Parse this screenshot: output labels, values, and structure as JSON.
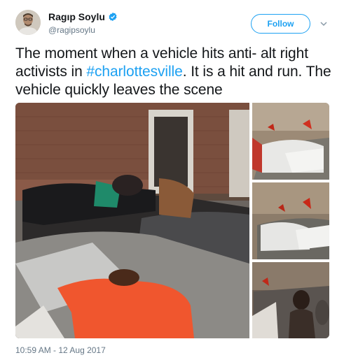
{
  "author": {
    "name": "Ragıp Soylu",
    "handle": "@ragipsoylu",
    "verified": true
  },
  "follow_button": {
    "label": "Follow"
  },
  "tweet": {
    "text_before": "The moment when a vehicle hits anti- alt right activists in ",
    "hashtag": "#charlottesville",
    "text_after": ". It is a hit and run. The vehicle quickly leaves the scene"
  },
  "media": {
    "count": 4
  },
  "timestamp": "10:59 AM - 12 Aug 2017",
  "colors": {
    "accent": "#1da1f2",
    "text": "#14171a",
    "secondary": "#657786"
  }
}
